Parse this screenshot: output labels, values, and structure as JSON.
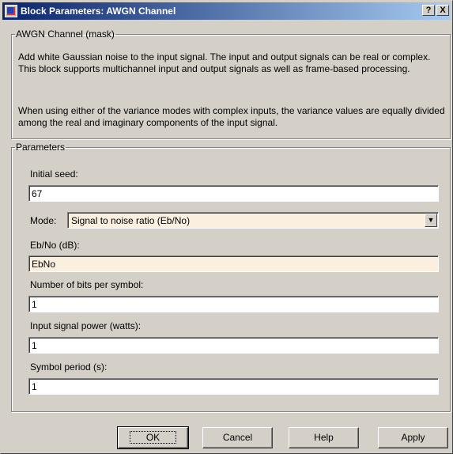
{
  "window": {
    "title": "Block Parameters: AWGN Channel",
    "help_btn": "?",
    "close_btn": "X"
  },
  "mask": {
    "group_title": "AWGN Channel (mask)",
    "description_1": "Add white Gaussian noise to the input signal. The input and output signals can be real or complex. This block supports multichannel input and output signals as well as frame-based processing.",
    "description_2": "When using either of the variance modes with complex inputs, the variance values are equally divided among the real and imaginary components of the input signal."
  },
  "parameters": {
    "group_title": "Parameters",
    "initial_seed_label": "Initial seed:",
    "initial_seed_value": "67",
    "mode_label": "Mode:",
    "mode_value": "Signal to noise ratio  (Eb/No)",
    "ebno_label": "Eb/No (dB):",
    "ebno_value": "EbNo",
    "bits_label": "Number of bits per symbol:",
    "bits_value": "1",
    "power_label": "Input signal power (watts):",
    "power_value": "1",
    "period_label": "Symbol period (s):",
    "period_value": "1"
  },
  "buttons": {
    "ok": "OK",
    "cancel": "Cancel",
    "help": "Help",
    "apply": "Apply"
  }
}
